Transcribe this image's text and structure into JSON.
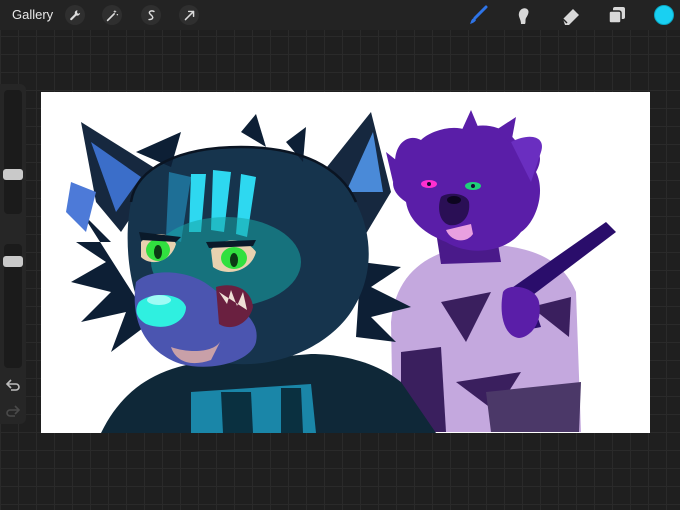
{
  "topbar": {
    "gallery_label": "Gallery",
    "left_tools": [
      "wrench-icon",
      "magic-wand-icon",
      "selection-icon",
      "transform-arrow-icon"
    ],
    "right_tools": [
      "brush-icon",
      "smudge-icon",
      "eraser-icon",
      "layers-icon"
    ],
    "current_color": "#19d0f2"
  },
  "sidebar": {
    "controls": [
      "brush-size-slider",
      "modify-button",
      "opacity-slider",
      "undo-button",
      "redo-button"
    ]
  },
  "canvas": {
    "background": "#ffffff",
    "artwork": "two-character-illustration"
  },
  "colors": {
    "accent": "#19d0f2",
    "app_background": "#1f1f1f",
    "toolbar": "#232323"
  }
}
